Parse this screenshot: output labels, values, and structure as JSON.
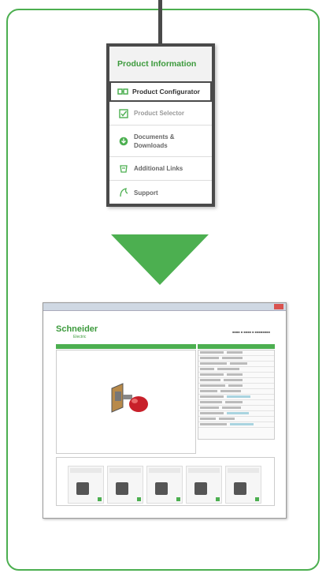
{
  "menu": {
    "header": "Product Information",
    "configurator": "Product Configurator",
    "items": [
      {
        "label": "Product Selector",
        "icon": "checkbox-icon"
      },
      {
        "label": "Documents & Downloads",
        "icon": "download-icon"
      },
      {
        "label": "Additional Links",
        "icon": "links-icon"
      },
      {
        "label": "Support",
        "icon": "support-icon"
      }
    ]
  },
  "screenshot": {
    "logo": "Schneider",
    "logo_sub": "Electric"
  },
  "colors": {
    "accent": "#4caf50",
    "header_green": "#3c9a3c",
    "menu_dark": "#4a4a4a"
  }
}
